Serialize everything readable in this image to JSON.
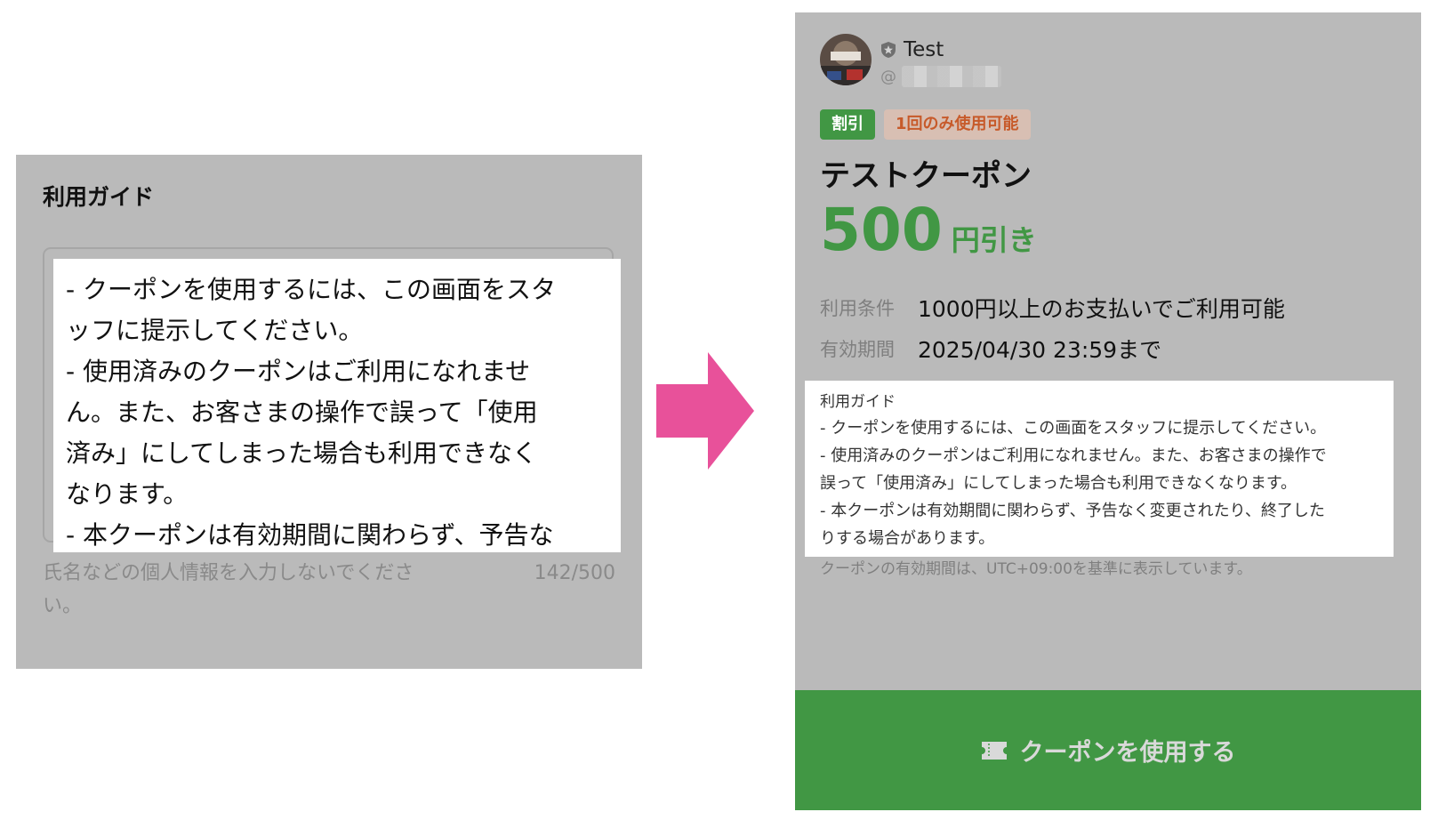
{
  "left": {
    "title": "利用ガイド",
    "textarea_lines": [
      "- クーポンを使用するには、この画面をスタ",
      "ッフに提示してください。",
      "- 使用済みのクーポンはご利用になれませ",
      "ん。また、お客さまの操作で誤って「使用",
      "済み」にしてしまった場合も利用できなく",
      "なります。",
      "- 本クーポンは有効期間に関わらず、予告な"
    ],
    "helper_text": "氏名などの個人情報を入力しないでください。",
    "char_count": "142/500"
  },
  "arrow": {
    "color": "#e8519a"
  },
  "coupon": {
    "account_name": "Test",
    "account_handle_prefix": "@",
    "badges": {
      "discount": "割引",
      "once": "1回のみ使用可能"
    },
    "title": "テストクーポン",
    "amount": "500",
    "amount_unit": "円引き",
    "conditions_label": "利用条件",
    "conditions_value": "1000円以上のお支払いでご利用可能",
    "validity_label": "有効期間",
    "validity_value": "2025/04/30 23:59まで",
    "guide_title": "利用ガイド",
    "guide_lines": [
      "- クーポンを使用するには、この画面をスタッフに提示してください。",
      "- 使用済みのクーポンはご利用になれません。また、お客さまの操作で",
      "誤って「使用済み」にしてしまった場合も利用できなくなります。",
      "- 本クーポンは有効期間に関わらず、予告なく変更されたり、終了した",
      "りする場合があります。"
    ],
    "timezone_note": "クーポンの有効期間は、UTC+09:00を基準に表示しています。",
    "use_button_label": "クーポンを使用する"
  },
  "colors": {
    "accent_green": "#419744",
    "panel_gray": "#bababa",
    "badge_once_bg": "#d8bfb3",
    "badge_once_text": "#c75a2a",
    "arrow_pink": "#e8519a"
  },
  "icons": {
    "verified": "shield-star-icon",
    "coupon": "ticket-icon"
  }
}
